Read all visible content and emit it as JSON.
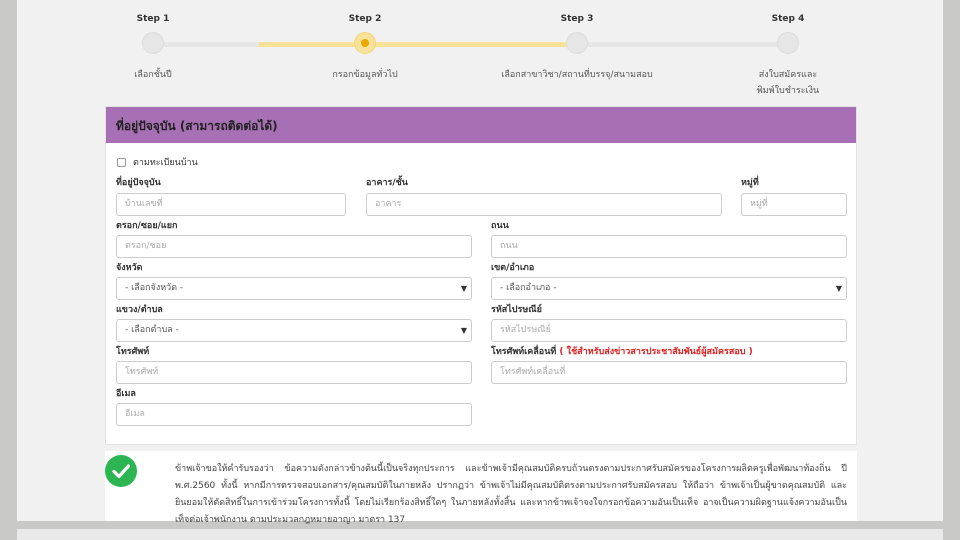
{
  "steps": [
    {
      "title": "Step 1",
      "label": "เลือกชั้นปี"
    },
    {
      "title": "Step 2",
      "label": "กรอกข้อมูลทั่วไป"
    },
    {
      "title": "Step 3",
      "label": "เลือกสาขาวิชา/สถานที่บรรจุ/สนามสอบ"
    },
    {
      "title": "Step 4",
      "label": "ส่งใบสมัครและ\nพิมพ์ใบชำระเงิน"
    }
  ],
  "current_step": 2,
  "colors": {
    "header": "#a870b4",
    "step_active": "#f8e29a",
    "step_dot": "#e8a800",
    "note_red": "#e02020",
    "ok_green": "#2db553"
  },
  "form": {
    "title": "ที่อยู่ปัจจุบัน (สามารถติดต่อได้)",
    "same_as_house_reg": "ตามทะเบียนบ้าน",
    "address_label": "ที่อยู่ปัจจุบัน",
    "address_placeholder": "บ้านเลขที่",
    "building_label": "อาคาร/ชั้น",
    "building_placeholder": "อาคาร",
    "moo_label": "หมู่ที่",
    "moo_placeholder": "หมู่ที่",
    "soi_label": "ตรอก/ซอย/แยก",
    "soi_placeholder": "ตรอก/ซอย",
    "road_label": "ถนน",
    "road_placeholder": "ถนน",
    "province_label": "จังหวัด",
    "province_value": "- เลือกจังหวัด -",
    "district_label": "เขต/อำเภอ",
    "district_value": "- เลือกอำเภอ -",
    "subdistrict_label": "แขวง/ตำบล",
    "subdistrict_value": "- เลือกตำบล -",
    "postcode_label": "รหัสไปรษณีย์",
    "postcode_placeholder": "รหัสไปรษณีย์",
    "phone_label": "โทรศัพท์",
    "phone_placeholder": "โทรศัพท์",
    "mobile_label": "โทรศัพท์เคลื่อนที่",
    "mobile_note": "( ใช้สำหรับส่งข่าวสารประชาสัมพันธ์ผู้สมัครสอบ )",
    "mobile_placeholder": "โทรศัพท์เคลื่อนที่",
    "email_label": "อีเมล",
    "email_placeholder": "อีเมล"
  },
  "declaration": {
    "icon": "check-circle-icon",
    "text": "ข้าพเจ้าขอให้คำรับรองว่า ข้อความดังกล่าวข้างต้นนี้เป็นจริงทุกประการ และข้าพเจ้ามีคุณสมบัติครบถ้วนตรงตามประกาศรับสมัครของโครงการผลิตครูเพื่อพัฒนาท้องถิ่น ปี พ.ศ.2560 ทั้งนี้ หากมีการตรวจสอบเอกสาร/คุณสมบัติในภายหลัง ปรากฏว่า ข้าพเจ้าไม่มีคุณสมบัติตรงตามประกาศรับสมัครสอบ ให้ถือว่า ข้าพเจ้าเป็นผู้ขาดคุณสมบัติ และยินยอมให้ตัดสิทธิ์ในการเข้าร่วมโครงการทั้งนี้ โดยไม่เรียกร้องสิทธิ์ใดๆ ในภายหลังทั้งสิ้น และหากข้าพเจ้าจงใจกรอกข้อความอันเป็นเท็จ อาจเป็นความผิดฐานแจ้งความอันเป็นเท็จต่อเจ้าพนักงาน ตามประมวลกฎหมายอาญา มาตรา 137"
  }
}
